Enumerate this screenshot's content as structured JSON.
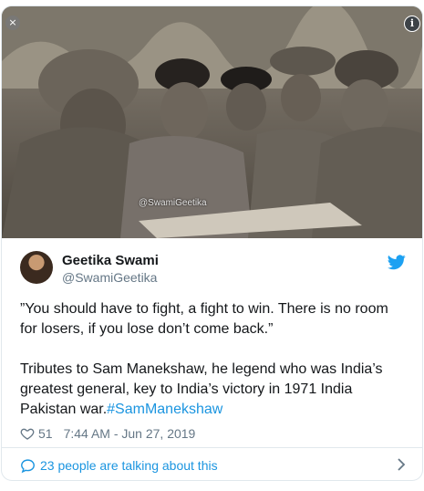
{
  "tweet": {
    "author_name": "Geetika Swami",
    "author_handle": "@SwamiGeetika",
    "text_part1": "”You should have to fight, a fight to win. There is no room for losers, if you lose don’t come back.”\n\nTributes to Sam Manekshaw, he legend who was India’s greatest general, key to India’s victory in 1971 India Pakistan war.",
    "hashtag": "#SamManekshaw",
    "likes": "51",
    "timestamp": "7:44 AM - Jun 27, 2019",
    "talking": "23 people are talking about this"
  },
  "media": {
    "watermark": "@SwamiGeetika",
    "close_glyph": "×",
    "info_glyph": "i"
  },
  "colors": {
    "link": "#1b95e0",
    "muted": "#657786",
    "border": "#e1e8ed",
    "twitter_blue": "#1da1f2"
  },
  "icons": [
    "close-icon",
    "info-icon",
    "twitter-bird-icon",
    "heart-icon",
    "speech-bubble-icon",
    "chevron-right-icon"
  ]
}
